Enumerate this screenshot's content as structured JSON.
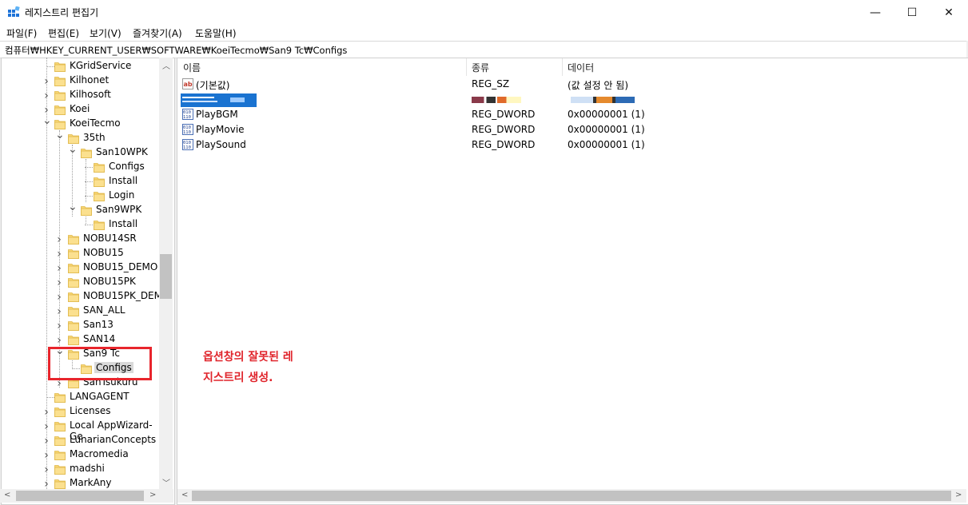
{
  "window": {
    "title": "레지스트리 편집기",
    "controls": {
      "minimize": "—",
      "maximize": "☐",
      "close": "✕"
    }
  },
  "menu": [
    "파일(F)",
    "편집(E)",
    "보기(V)",
    "즐겨찾기(A)",
    "도움말(H)"
  ],
  "address": "컴퓨터₩HKEY_CURRENT_USER₩SOFTWARE₩KoeiTecmo₩San9 Tc₩Configs",
  "tree": {
    "items": [
      "KGridService",
      "Kilhonet",
      "Kilhosoft",
      "Koei",
      "KoeiTecmo",
      "35th",
      "San10WPK",
      "Configs",
      "Install",
      "Login",
      "San9WPK",
      "Install",
      "NOBU14SR",
      "NOBU15",
      "NOBU15_DEMO",
      "NOBU15PK",
      "NOBU15PK_DEMO",
      "SAN_ALL",
      "San13",
      "SAN14",
      "San9 Tc",
      "Configs",
      "SanTsukuru",
      "LANGAGENT",
      "Licenses",
      "Local AppWizard-Ge",
      "LunarianConcepts",
      "Macromedia",
      "madshi",
      "MarkAny"
    ]
  },
  "list": {
    "columns": {
      "name": "이름",
      "type": "종류",
      "data": "데이터"
    },
    "rows": [
      {
        "name": "(기본값)",
        "type": "REG_SZ",
        "data": "(값 설정 안 됨)",
        "icon": "string-value-icon"
      },
      {
        "name": "",
        "type": "",
        "data": "",
        "icon": "redacted"
      },
      {
        "name": "PlayBGM",
        "type": "REG_DWORD",
        "data": "0x00000001 (1)",
        "icon": "binary-value-icon"
      },
      {
        "name": "PlayMovie",
        "type": "REG_DWORD",
        "data": "0x00000001 (1)",
        "icon": "binary-value-icon"
      },
      {
        "name": "PlaySound",
        "type": "REG_DWORD",
        "data": "0x00000001 (1)",
        "icon": "binary-value-icon"
      }
    ]
  },
  "annotation": {
    "line1": "옵션창의 잘못된 레",
    "line2": "지스트리 생성.",
    "color": "#e0242b"
  }
}
